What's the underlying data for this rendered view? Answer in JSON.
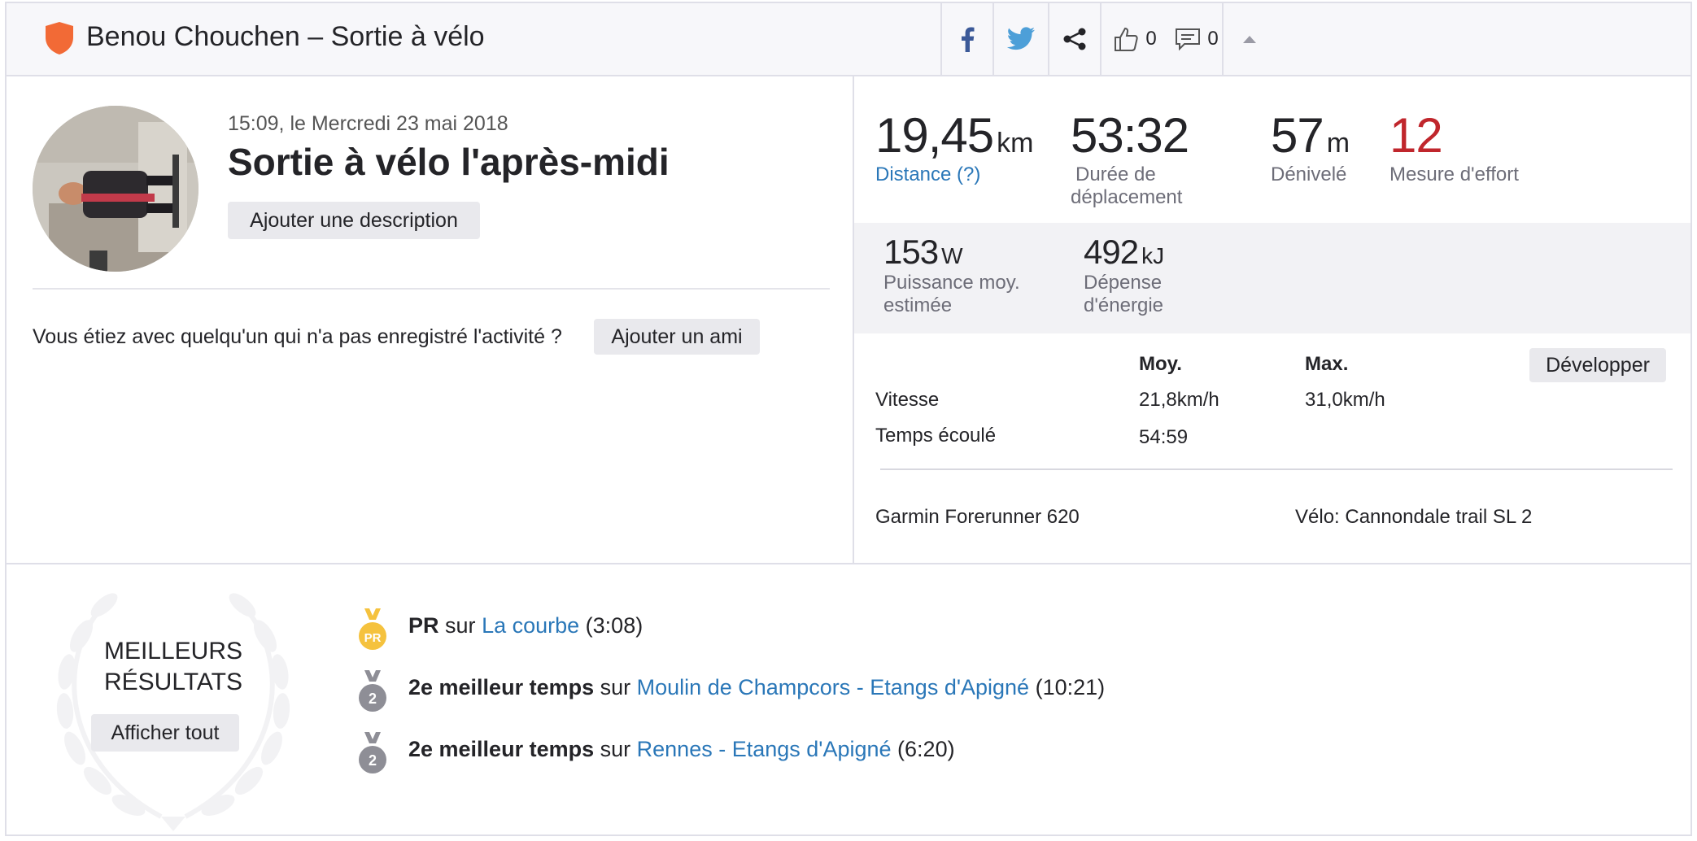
{
  "header": {
    "title": "Benou Chouchen – Sortie à vélo",
    "kudos_count": "0",
    "comments_count": "0"
  },
  "activity": {
    "datetime": "15:09, le Mercredi 23 mai 2018",
    "title": "Sortie à vélo l'après-midi",
    "add_description": "Ajouter une description",
    "friend_question": "Vous étiez avec quelqu'un qui n'a pas enregistré l'activité ?",
    "add_friend": "Ajouter un ami"
  },
  "stats": {
    "distance": {
      "value": "19,45",
      "unit": "km",
      "label": "Distance (?)"
    },
    "moving_time": {
      "value": "53:32",
      "label_line1": "Durée de",
      "label_line2": "déplacement"
    },
    "elevation": {
      "value": "57",
      "unit": "m",
      "label": "Dénivelé"
    },
    "effort": {
      "value": "12",
      "label": "Mesure d'effort"
    },
    "power": {
      "value": "153",
      "unit": "W",
      "label_line1": "Puissance moy.",
      "label_line2": "estimée"
    },
    "energy": {
      "value": "492",
      "unit": "kJ",
      "label_line1": "Dépense",
      "label_line2": "d'énergie"
    }
  },
  "table": {
    "col_avg": "Moy.",
    "col_max": "Max.",
    "expand": "Développer",
    "speed_label": "Vitesse",
    "speed_avg": "21,8km/h",
    "speed_max": "31,0km/h",
    "elapsed_label": "Temps écoulé",
    "elapsed_avg": "54:59"
  },
  "gear": {
    "device": "Garmin Forerunner 620",
    "bike": "Vélo: Cannondale trail SL 2"
  },
  "best": {
    "title_line1": "MEILLEURS",
    "title_line2": "RÉSULTATS",
    "show_all": "Afficher tout",
    "items": [
      {
        "medal": "PR",
        "rank": "PR",
        "sur": "sur",
        "segment": "La courbe",
        "time": "(3:08)"
      },
      {
        "medal": "2",
        "rank": "2e meilleur temps",
        "sur": "sur",
        "segment": "Moulin de Champcors - Etangs d'Apigné",
        "time": "(10:21)"
      },
      {
        "medal": "2",
        "rank": "2e meilleur temps",
        "sur": "sur",
        "segment": "Rennes - Etangs d'Apigné",
        "time": "(6:20)"
      }
    ]
  },
  "colors": {
    "brand": "#fc5200",
    "link": "#2a77b8",
    "effort": "#c0262c"
  }
}
